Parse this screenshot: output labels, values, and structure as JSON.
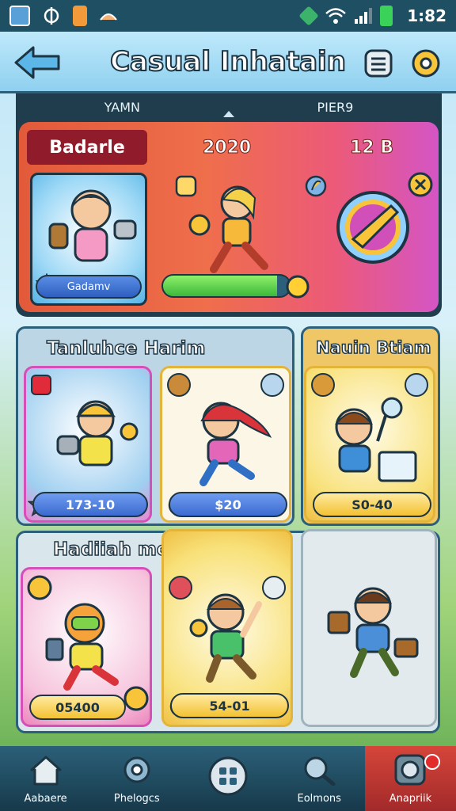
{
  "status": {
    "time": "1:82",
    "icons": [
      "gallery-icon",
      "sync-icon",
      "battery-saver-icon",
      "wind-icon",
      "nfc-icon",
      "wifi-icon",
      "signal-icon",
      "battery-icon"
    ]
  },
  "header": {
    "title": "Casual Inhatain",
    "back_icon": "back-arrow-icon",
    "list_icon": "list-icon",
    "gear_icon": "gear-icon"
  },
  "tabs": [
    {
      "label": "YAMN"
    },
    {
      "label": "PIER9"
    }
  ],
  "featured": {
    "badge": "Badarle",
    "year": "2020",
    "points": "12 B",
    "hero_label": "Gadamv",
    "progress": 0.9
  },
  "sections": [
    {
      "title": "Tanluhce Harim",
      "cards": [
        {
          "value": "173-10"
        },
        {
          "value": "$20"
        }
      ]
    },
    {
      "title": "Nauin Btiam",
      "cards": [
        {
          "value": "S0-40"
        }
      ]
    },
    {
      "title": "Hadiiah menoharik",
      "cards": [
        {
          "value": "05400"
        },
        {
          "value": "54-01"
        },
        {
          "value": ""
        }
      ]
    }
  ],
  "nav": [
    {
      "label": "Aabaere"
    },
    {
      "label": "Phelogcs"
    },
    {
      "label": ""
    },
    {
      "label": "Eolmons"
    },
    {
      "label": "Anapriik"
    }
  ],
  "colors": {
    "accent": "#f3c233",
    "nav_bg": "#1f4f63",
    "active": "#d6453a"
  }
}
